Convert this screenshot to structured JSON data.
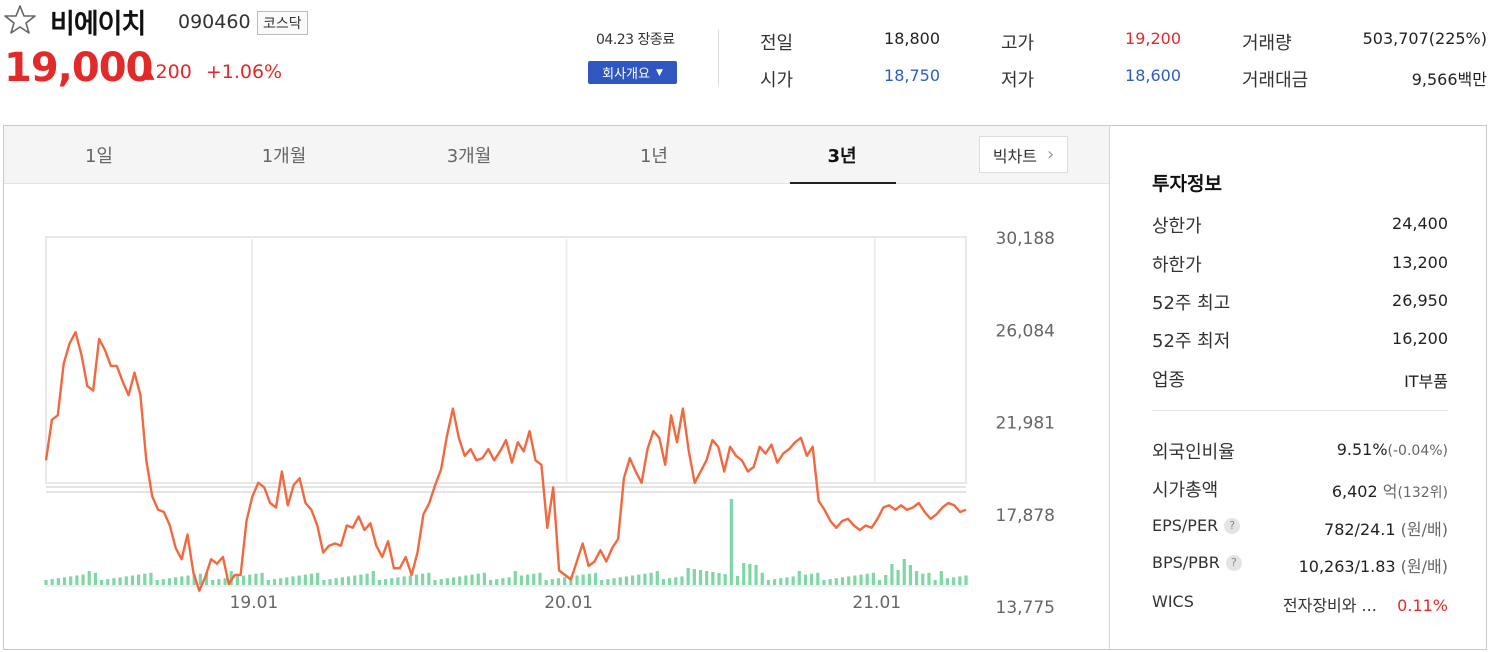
{
  "stock": {
    "name": "비에이치",
    "code": "090460",
    "market": "코스닥",
    "price": "19,000",
    "change_arrow": "▲",
    "change": "200",
    "change_pct": "+1.06%"
  },
  "session": {
    "date_status": "04.23 장종료",
    "overview_label": "회사개요"
  },
  "quote": {
    "prev_label": "전일",
    "prev_value": "18,800",
    "open_label": "시가",
    "open_value": "18,750",
    "high_label": "고가",
    "high_value": "19,200",
    "low_label": "저가",
    "low_value": "18,600",
    "volume_label": "거래량",
    "volume_value": "503,707(225%)",
    "amount_label": "거래대금",
    "amount_value": "9,566",
    "amount_unit": "백만"
  },
  "tabs": [
    {
      "label": "1일"
    },
    {
      "label": "1개월"
    },
    {
      "label": "3개월"
    },
    {
      "label": "1년"
    },
    {
      "label": "3년"
    }
  ],
  "active_tab": "3년",
  "bigchart_label": "빅차트",
  "colors": {
    "up": "#e22a2a",
    "down": "#2c5cc5",
    "line": "#f2683f",
    "volume": "#7fd7a6",
    "accent": "#2f57bf"
  },
  "info": {
    "title": "투자정보",
    "upper_limit_label": "상한가",
    "upper_limit": "24,400",
    "lower_limit_label": "하한가",
    "lower_limit": "13,200",
    "high52_label": "52주 최고",
    "high52": "26,950",
    "low52_label": "52주 최저",
    "low52": "16,200",
    "sector_label": "업종",
    "sector": "IT부품",
    "foreign_label": "외국인비율",
    "foreign_value": "9.51%",
    "foreign_change": "(-0.04%)",
    "mcap_label": "시가총액",
    "mcap_value": "6,402",
    "mcap_unit": "억",
    "mcap_rank": "(132위)",
    "eps_label": "EPS/PER",
    "eps_value": "782/24.1",
    "eps_unit": "(원/배)",
    "bps_label": "BPS/PBR",
    "bps_value": "10,263/1.83",
    "bps_unit": "(원/배)",
    "wics_label": "WICS",
    "wics_value": "전자장비와 ...",
    "wics_change": "0.11%"
  },
  "chart_data": {
    "type": "line",
    "title": "",
    "y_ticks": [
      "30,188",
      "26,084",
      "21,981",
      "17,878",
      "13,775"
    ],
    "y_tick_values": [
      30188,
      26084,
      21981,
      17878,
      13775
    ],
    "x_ticks": [
      "19.01",
      "20.01",
      "21.01"
    ],
    "x_tick_positions": [
      0.226,
      0.568,
      0.903
    ],
    "ylim": [
      13775,
      30188
    ],
    "grid": true,
    "series": [
      {
        "values": [
          20300,
          22100,
          22300,
          24600,
          25500,
          26000,
          25000,
          23600,
          23400,
          25700,
          25200,
          24500,
          24500,
          23800,
          23200,
          24200,
          23200,
          20300,
          18700,
          18100,
          18000,
          17400,
          16400,
          15900,
          17000,
          15300,
          14500,
          15100,
          15900,
          15700,
          16000,
          14800,
          15200,
          15200,
          17600,
          18700,
          19300,
          19100,
          18400,
          18200,
          19800,
          18300,
          19200,
          19500,
          18400,
          18100,
          17400,
          16200,
          16500,
          16600,
          16500,
          17400,
          17300,
          17800,
          17200,
          17500,
          16500,
          16000,
          16700,
          15500,
          15500,
          16000,
          15200,
          16200,
          17900,
          18400,
          19200,
          19900,
          21400,
          22600,
          21300,
          20500,
          20800,
          20300,
          20400,
          20800,
          20300,
          20700,
          21200,
          20200,
          21100,
          20700,
          21600,
          20300,
          20100,
          17300,
          19100,
          15400,
          15200,
          15000,
          15800,
          16600,
          15600,
          15800,
          16300,
          15800,
          16400,
          16800,
          19500,
          20400,
          19800,
          19300,
          20800,
          21600,
          21300,
          20100,
          22300,
          21100,
          22600,
          20700,
          19300,
          19800,
          20300,
          21200,
          20900,
          19800,
          20900,
          20500,
          20300,
          19800,
          20000,
          20900,
          20600,
          21000,
          20200,
          20600,
          20800,
          21100,
          21300,
          20500,
          20900,
          18500,
          18100,
          17600,
          17300,
          17600,
          17700,
          17400,
          17200,
          17400,
          17300,
          17700,
          18200,
          18300,
          18100,
          18300,
          18100,
          18200,
          18400,
          18000,
          17700,
          17900,
          18200,
          18400,
          18300,
          18000,
          18100
        ],
        "color": "#f2683f"
      }
    ]
  }
}
